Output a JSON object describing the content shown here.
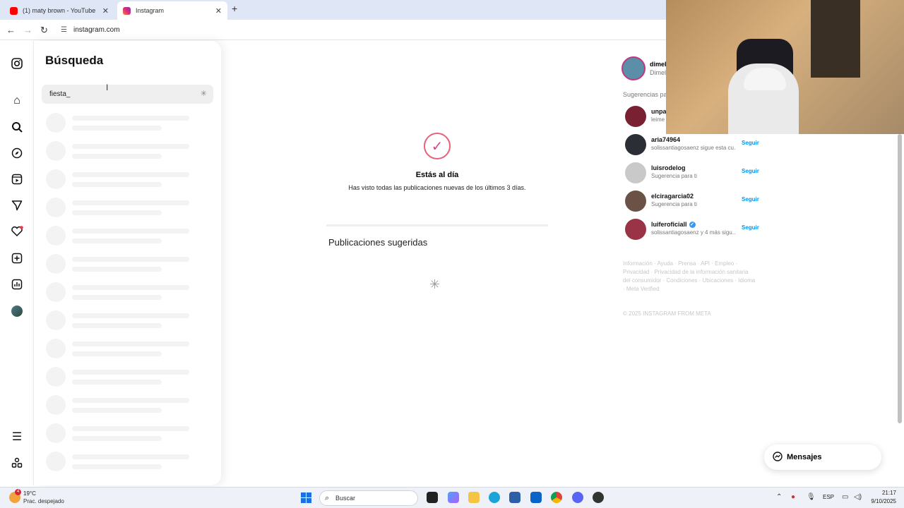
{
  "browser": {
    "tabs": [
      {
        "title": "(1) maty brown - YouTube",
        "close": "✕",
        "favicon_color": "#ff0000"
      },
      {
        "title": "Instagram",
        "close": "✕",
        "favicon_color": "#d62976"
      }
    ],
    "new_tab": "+",
    "url": "instagram.com"
  },
  "search_panel": {
    "title": "Búsqueda",
    "query": "fiesta_"
  },
  "feed": {
    "caught_up_title": "Estás al día",
    "caught_up_sub": "Has visto todas las publicaciones nuevas de los últimos 3 días.",
    "suggested_title": "Publicaciones sugeridas"
  },
  "right_panel": {
    "me_name": "dimel",
    "me_sub": "Dimel",
    "suggestions_head": "Sugerencias pa",
    "suggestions": [
      {
        "user": "unpa",
        "desc": "leime",
        "follow": "",
        "color": "#7a2033"
      },
      {
        "user": "aria74964",
        "desc": "solissantiagosaenz sigue esta cu...",
        "follow": "Seguir",
        "color": "#2b2f35"
      },
      {
        "user": "luisrodelog",
        "desc": "Sugerencia para ti",
        "follow": "Seguir",
        "color": "#c9c9c9"
      },
      {
        "user": "elciragarcia02",
        "desc": "Sugerencia para ti",
        "follow": "Seguir",
        "color": "#6b5246"
      },
      {
        "user": "luiferoficiall",
        "desc": "solissantiagosaenz y 4 más sigu...",
        "follow": "Seguir",
        "color": "#9b3346"
      }
    ],
    "footer": "Información · Ayuda · Prensa · API · Empleo · Privacidad · Privacidad de la información sanitaria del consumidor · Condiciones · Ubicaciones · Idioma · Meta Verified",
    "copyright": "© 2025 INSTAGRAM FROM META"
  },
  "messages": {
    "label": "Mensajes"
  },
  "taskbar": {
    "temperature": "19°C",
    "condition": "Prac. despejado",
    "weather_badge": "4",
    "search": "Buscar",
    "lang": "ESP",
    "time": "21:17",
    "date": "9/10/2025"
  }
}
